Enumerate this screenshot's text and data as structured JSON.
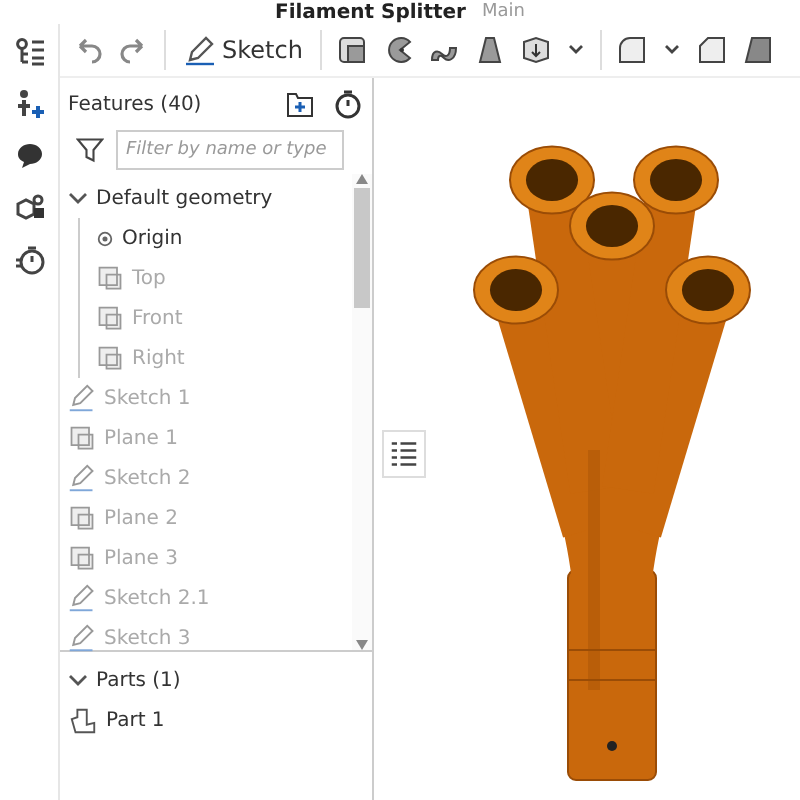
{
  "document": {
    "title": "Filament Splitter",
    "branch": "Main"
  },
  "toolbar": {
    "sketch_label": "Sketch"
  },
  "features": {
    "title": "Features (40)",
    "filter": {
      "placeholder": "Filter by name or type"
    },
    "tree": [
      {
        "label": "Default geometry",
        "kind": "group",
        "expanded": true,
        "dimmed": false,
        "children": [
          {
            "label": "Origin",
            "kind": "origin",
            "dimmed": false
          },
          {
            "label": "Top",
            "kind": "plane",
            "dimmed": true
          },
          {
            "label": "Front",
            "kind": "plane",
            "dimmed": true
          },
          {
            "label": "Right",
            "kind": "plane",
            "dimmed": true
          }
        ]
      },
      {
        "label": "Sketch 1",
        "kind": "sketch",
        "dimmed": true
      },
      {
        "label": "Plane 1",
        "kind": "plane",
        "dimmed": true
      },
      {
        "label": "Sketch 2",
        "kind": "sketch",
        "dimmed": true
      },
      {
        "label": "Plane 2",
        "kind": "plane",
        "dimmed": true
      },
      {
        "label": "Plane 3",
        "kind": "plane",
        "dimmed": true
      },
      {
        "label": "Sketch 2.1",
        "kind": "sketch",
        "dimmed": true
      },
      {
        "label": "Sketch 3",
        "kind": "sketch",
        "dimmed": true
      }
    ]
  },
  "parts": {
    "title": "Parts (1)",
    "expanded": true,
    "items": [
      {
        "label": "Part 1",
        "kind": "part"
      }
    ]
  }
}
